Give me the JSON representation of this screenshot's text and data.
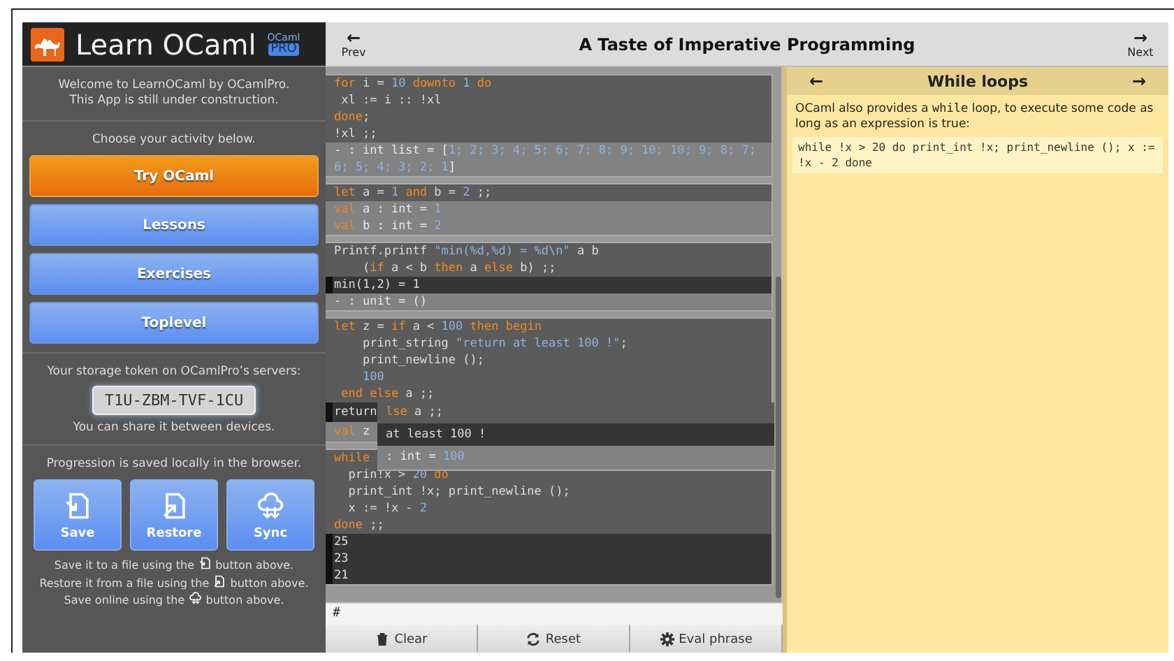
{
  "sidebar": {
    "logo_title": "Learn OCaml",
    "badge_top": "OCaml",
    "badge": "PRO",
    "welcome": [
      "Welcome to LearnOCaml by OCamlPro.",
      "This App is still under construction."
    ],
    "activity_prompt": "Choose your activity below.",
    "activities": [
      {
        "label": "Try OCaml",
        "selected": true
      },
      {
        "label": "Lessons",
        "selected": false
      },
      {
        "label": "Exercises",
        "selected": false
      },
      {
        "label": "Toplevel",
        "selected": false
      }
    ],
    "storage_label": "Your storage token on OCamlPro’s servers:",
    "token": "T1U-ZBM-TVF-1CU",
    "share_note": "You can share it between devices.",
    "progress_note": "Progression is saved locally in the browser.",
    "actions": [
      {
        "label": "Save",
        "kind": "save"
      },
      {
        "label": "Restore",
        "kind": "restore"
      },
      {
        "label": "Sync",
        "kind": "sync"
      }
    ],
    "help": [
      {
        "before": "Save it to a file using the",
        "kind": "save",
        "after": "button above."
      },
      {
        "before": "Restore it from a file using the",
        "kind": "restore",
        "after": "button above."
      },
      {
        "before": "Save online using the",
        "kind": "sync",
        "after": "button above."
      }
    ]
  },
  "header": {
    "prev_arrow": "←",
    "prev": "Prev",
    "title": "A Taste of Imperative Programming",
    "next_arrow": "→",
    "next": "Next"
  },
  "toplevel": {
    "blocks": [
      {
        "input": [
          [
            {
              "text": "for",
              "kind": "kw"
            },
            {
              "text": " i = "
            },
            {
              "text": "10",
              "kind": "lit"
            },
            {
              "text": " downto ",
              "kind": "kw"
            },
            {
              "text": "1",
              "kind": "lit"
            },
            {
              "text": " do",
              "kind": "kw"
            }
          ],
          [
            {
              "text": " xl := i :: !xl"
            }
          ],
          [
            {
              "text": "done",
              "kind": "kw"
            },
            {
              "text": ";"
            }
          ],
          [
            {
              "text": "!xl ;;"
            }
          ]
        ],
        "outputs": [
          {
            "kind": "value",
            "segments": [
              {
                "text": "- : int list = ["
              },
              {
                "text": "1; 2; 3; 4; 5; 6; 7; 8; 9; 10; 10; 9; 8; 7; 6; 5; 4; 3; 2; 1",
                "kind": "lit"
              },
              {
                "text": "]"
              }
            ]
          }
        ]
      },
      {
        "input": [
          [
            {
              "text": "let",
              "kind": "kw"
            },
            {
              "text": " a = "
            },
            {
              "text": "1",
              "kind": "lit"
            },
            {
              "text": " and",
              "kind": "kw"
            },
            {
              "text": " b = "
            },
            {
              "text": "2",
              "kind": "lit"
            },
            {
              "text": " ;;"
            }
          ]
        ],
        "outputs": [
          {
            "kind": "value",
            "segments": [
              {
                "text": "val",
                "kind": "kw"
              },
              {
                "text": " a : int = "
              },
              {
                "text": "1",
                "kind": "lit"
              }
            ]
          },
          {
            "kind": "value",
            "segments": [
              {
                "text": "val",
                "kind": "kw"
              },
              {
                "text": " b : int = "
              },
              {
                "text": "2",
                "kind": "lit"
              }
            ]
          }
        ]
      },
      {
        "input": [
          [
            {
              "text": "Printf.printf "
            },
            {
              "text": "\"min(%d,%d) = %d\\n\"",
              "kind": "lit"
            },
            {
              "text": " a b"
            }
          ],
          [
            {
              "text": "    ("
            },
            {
              "text": "if",
              "kind": "kw"
            },
            {
              "text": " a < b "
            },
            {
              "text": "then",
              "kind": "kw"
            },
            {
              "text": " a "
            },
            {
              "text": "else",
              "kind": "kw"
            },
            {
              "text": " b) ;;"
            }
          ]
        ],
        "outputs": [
          {
            "kind": "stdout",
            "segments": [
              {
                "text": "min(1,2) = 1"
              }
            ]
          },
          {
            "kind": "value",
            "segments": [
              {
                "text": "- : unit = ()"
              }
            ]
          }
        ]
      },
      {
        "input": [
          [
            {
              "text": "let",
              "kind": "kw"
            },
            {
              "text": " z = "
            },
            {
              "text": "if",
              "kind": "kw"
            },
            {
              "text": " a < "
            },
            {
              "text": "100",
              "kind": "lit"
            },
            {
              "text": " then begin",
              "kind": "kw"
            }
          ],
          [
            {
              "text": "    print_string "
            },
            {
              "text": "\"return at least 100 !\"",
              "kind": "lit"
            },
            {
              "text": ";"
            }
          ],
          [
            {
              "text": "    print_newline ();"
            }
          ],
          [
            {
              "text": "    100",
              "kind": "lit"
            }
          ],
          [
            {
              "text": " end else",
              "kind": "kw"
            },
            {
              "text": " a ;;"
            }
          ]
        ],
        "outputs": [
          {
            "kind": "stdout",
            "segments": [
              {
                "text": "return"
              }
            ]
          },
          {
            "kind": "value",
            "segments": [
              {
                "text": "val",
                "kind": "kw"
              },
              {
                "text": " z"
              }
            ]
          }
        ],
        "overlay": [
          {
            "kind": "input",
            "segments": [
              {
                "text": "lse",
                "kind": "kw"
              },
              {
                "text": " a ;;"
              }
            ]
          },
          {
            "kind": "stdout",
            "segments": [
              {
                "text": "at least 100 !"
              }
            ]
          },
          {
            "kind": "value",
            "segments": [
              {
                "text": ": int = "
              },
              {
                "text": "100",
                "kind": "lit"
              }
            ]
          }
        ]
      },
      {
        "input": [
          [
            {
              "text": "while",
              "kind": "kw"
            }
          ],
          [
            {
              "text": "  prin!x > "
            },
            {
              "text": "20",
              "kind": "lit"
            },
            {
              "text": " do",
              "kind": "kw"
            }
          ],
          [
            {
              "text": "  print_int !x; print_newline ();"
            }
          ],
          [
            {
              "text": "  x := !x - "
            },
            {
              "text": "2",
              "kind": "lit"
            }
          ],
          [
            {
              "text": "done",
              "kind": "kw"
            },
            {
              "text": " ;;"
            }
          ]
        ],
        "outputs": [
          {
            "kind": "stdout",
            "segments": [
              {
                "text": "25"
              }
            ]
          },
          {
            "kind": "stdout",
            "segments": [
              {
                "text": "23"
              }
            ]
          },
          {
            "kind": "stdout",
            "segments": [
              {
                "text": "21"
              }
            ]
          }
        ]
      }
    ],
    "prompt": "#",
    "buttons": [
      {
        "label": "Clear",
        "kind": "clear"
      },
      {
        "label": "Reset",
        "kind": "reset"
      },
      {
        "label": "Eval phrase",
        "kind": "eval"
      }
    ]
  },
  "lesson": {
    "prev_arrow": "←",
    "title": "While loops",
    "next_arrow": "→",
    "paragraph": [
      {
        "text": "OCaml also provides a "
      },
      {
        "text": "while",
        "kind": "code"
      },
      {
        "text": " loop, to execute some code as long as an expression is true:"
      }
    ],
    "code": "while !x > 20 do print_int !x; print_newline (); x := !x - 2 done"
  }
}
